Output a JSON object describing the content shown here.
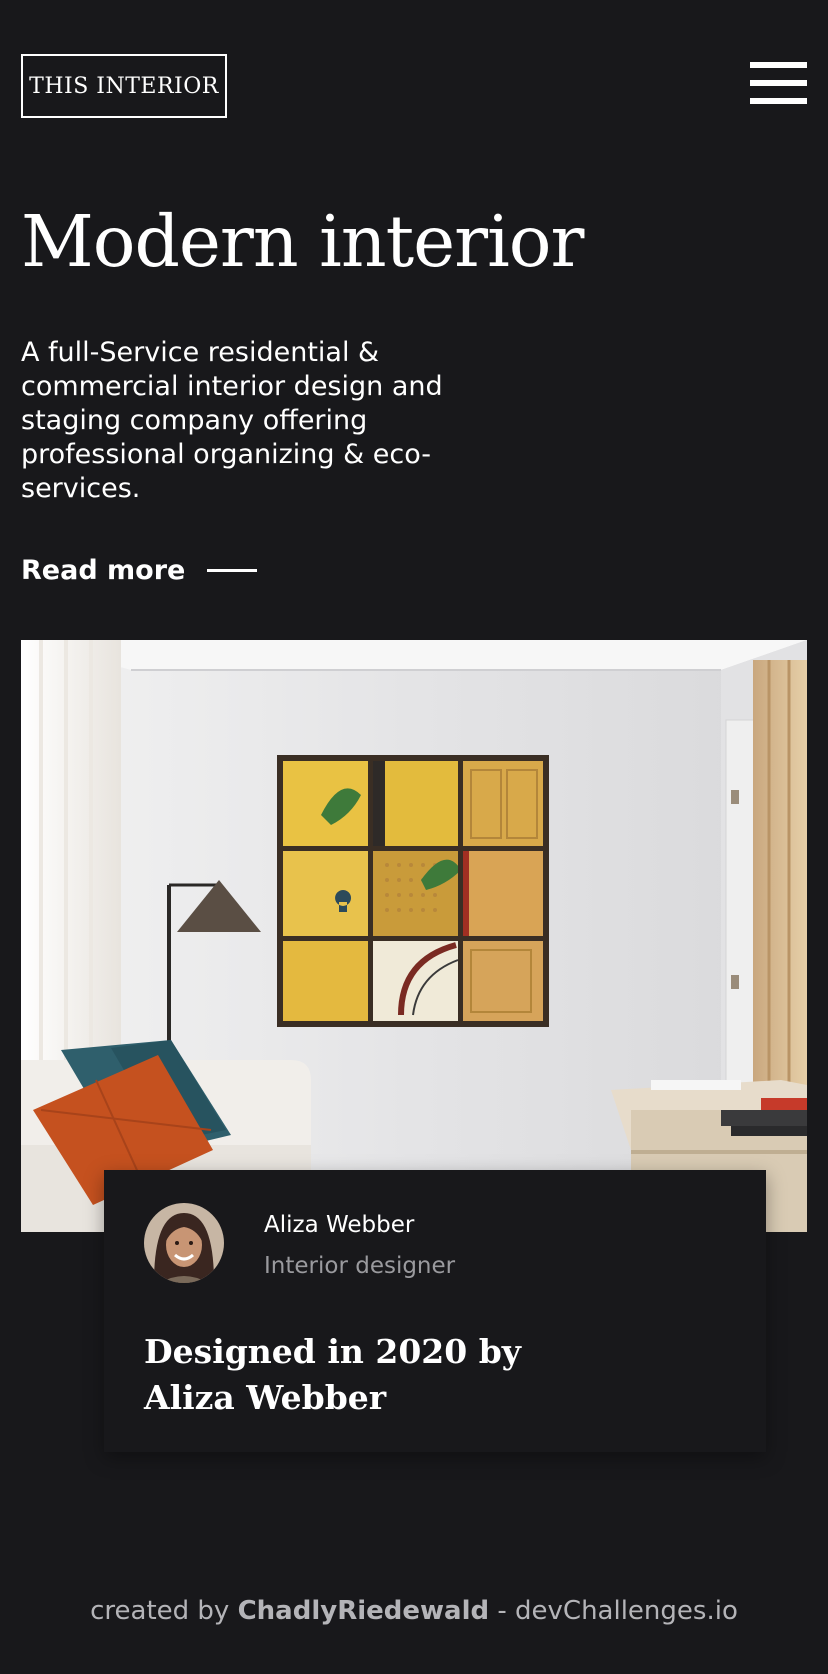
{
  "header": {
    "logo_text": "THIS INTERIOR",
    "menu_icon": "hamburger-menu-icon"
  },
  "hero": {
    "title": "Modern interior",
    "description": "A full-Service residential & commercial interior design and staging company offering professional organizing & eco-services.",
    "read_more_label": "Read more"
  },
  "feature_image": {
    "subject": "living-room-photo"
  },
  "card": {
    "author_name": "Aliza Webber",
    "author_role": "Interior designer",
    "title": "Designed in 2020 by Aliza Webber"
  },
  "footer": {
    "prefix": "created by",
    "author": "ChadlyRiedewald",
    "separator": "-",
    "site": "devChallenges.io"
  },
  "colors": {
    "background": "#18181b",
    "text": "#ffffff",
    "muted_text": "#9a9a9e",
    "footer_text": "#b4b4b8"
  }
}
